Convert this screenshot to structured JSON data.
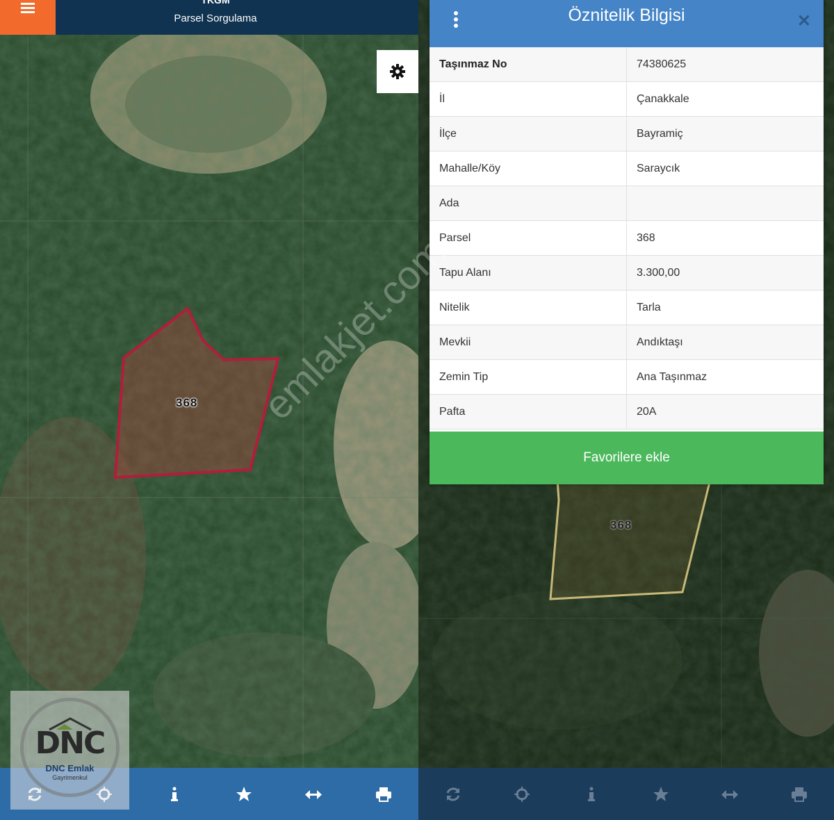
{
  "left_panel": {
    "header": {
      "org": "TKGM",
      "title": "Parsel Sorgulama"
    },
    "parcel_label": "368",
    "toolbar": {
      "icons": [
        "refresh-icon",
        "crosshair-icon",
        "info-icon",
        "star-icon",
        "measure-icon",
        "print-icon"
      ]
    }
  },
  "right_panel": {
    "parcel_label": "368",
    "modal": {
      "title": "Öznitelik Bilgisi",
      "close_label": "✕",
      "rows": [
        {
          "key": "Taşınmaz No",
          "value": "74380625"
        },
        {
          "key": "İl",
          "value": "Çanakkale"
        },
        {
          "key": "İlçe",
          "value": "Bayramiç"
        },
        {
          "key": "Mahalle/Köy",
          "value": "Saraycık"
        },
        {
          "key": "Ada",
          "value": ""
        },
        {
          "key": "Parsel",
          "value": "368"
        },
        {
          "key": "Tapu Alanı",
          "value": "3.300,00"
        },
        {
          "key": "Nitelik",
          "value": "Tarla"
        },
        {
          "key": "Mevkii",
          "value": "Andıktaşı"
        },
        {
          "key": "Zemin Tip",
          "value": "Ana Taşınmaz"
        },
        {
          "key": "Pafta",
          "value": "20A"
        }
      ],
      "favorite_button": "Favorilere ekle"
    }
  },
  "logo": {
    "mark": "DNC",
    "name": "DNC Emlak",
    "sub": "Gayrimenkul"
  },
  "watermark": "emlakjet.com",
  "colors": {
    "header_dark": "#0f3350",
    "menu_orange": "#f26b2d",
    "modal_header": "#4584c7",
    "favorite_green": "#4cb85c",
    "toolbar_blue": "#2e6ca8",
    "parcel_outline_left": "#b01e3a",
    "parcel_outline_right": "#c8b878"
  }
}
